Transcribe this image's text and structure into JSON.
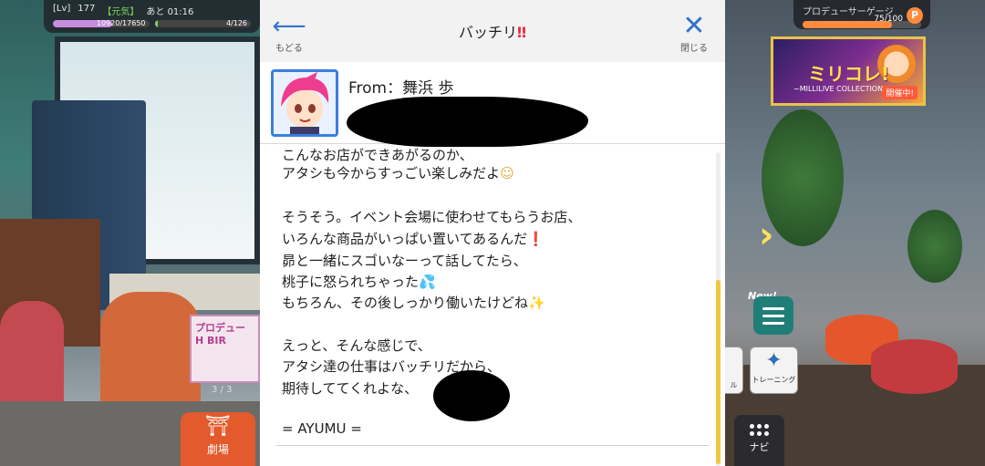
{
  "hud_left": {
    "level_label": "[Lv]",
    "level_value": "177",
    "mood_label": "【元気】",
    "time_label": "あと 01:16",
    "exp_text": "10920/17650",
    "exp_fraction": 0.62,
    "stamina_text": "4/126",
    "stamina_fraction": 0.03
  },
  "hud_right": {
    "label": "プロデューサーゲージ",
    "value_text": "75/100",
    "fraction": 0.75,
    "p_icon": "P"
  },
  "banner": {
    "title": "ミリコレ!",
    "subtitle": "~MILLILIVE COLLECTION~",
    "badge": "開催中!"
  },
  "side_buttons": {
    "next_chevron": "›",
    "new_label": "New!",
    "training_label": "トレーニング",
    "partial_label": "ル",
    "navi_label": "ナビ",
    "theater_label": "劇場",
    "page_indicator": "3 / 3",
    "poster_text": "プロデュー H BIR"
  },
  "modal": {
    "back_label": "もどる",
    "close_label": "閉じる",
    "title": "バッチリ",
    "title_mark": "‼",
    "from_label": "From：舞浜 歩"
  },
  "message": {
    "lines": [
      "こんなお店ができあがるのか、",
      "アタシも今からすっごい楽しみだよ",
      "",
      "そうそう。イベント会場に使わせてもらうお店、",
      "いろんな商品がいっぱい置いてあるんだ",
      "昴と一緒にスゴいなーって話してたら、",
      "桃子に怒られちゃった",
      "もちろん、その後しっかり働いたけどね",
      "",
      "えっと、そんな感じで、",
      "アタシ達の仕事はバッチリだから、",
      "期待しててくれよな、",
      "",
      "= AYUMU ="
    ],
    "emoji_smile": "☺",
    "emoji_exclaim": "❗",
    "emoji_sweat": "💦",
    "emoji_sparkle": "✨"
  },
  "colors": {
    "accent_blue": "#3573c9",
    "title_red": "#e8283c",
    "scroll_thumb": "#f0c840",
    "avatar_border": "#3a7fe0"
  }
}
